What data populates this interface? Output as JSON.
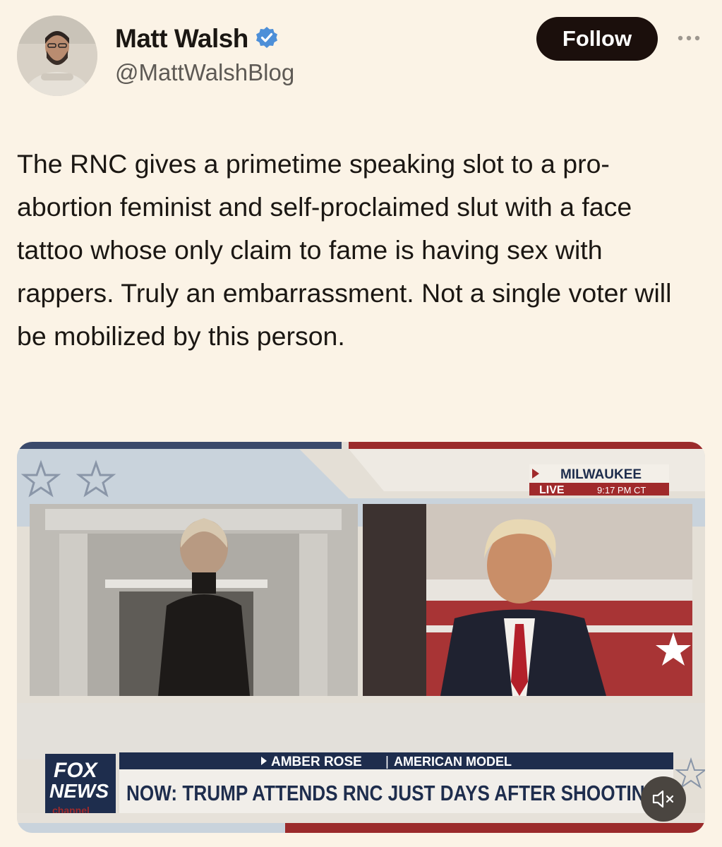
{
  "author": {
    "name": "Matt Walsh",
    "handle": "@MattWalshBlog",
    "verified_icon": "verified-badge-icon"
  },
  "actions": {
    "follow_label": "Follow",
    "more_icon": "more-options-icon"
  },
  "tweet": {
    "text": "The RNC gives a primetime speaking slot to a pro-abortion feminist and self-proclaimed slut with a face tattoo whose only claim to fame is having sex with rappers. Truly an embarrassment. Not a single voter will be mobilized by this person."
  },
  "video": {
    "location": "MILWAUKEE",
    "live_label": "LIVE",
    "time": "9:17 PM CT",
    "lower_third_name": "AMBER ROSE",
    "lower_third_role": "AMERICAN MODEL",
    "headline": "NOW: TRUMP ATTENDS RNC JUST DAYS AFTER SHOOTING",
    "network_top": "FOX",
    "network_mid": "NEWS",
    "network_bottom": "channel",
    "mute_icon": "speaker-muted-icon"
  },
  "colors": {
    "background": "#fbf3e6",
    "follow_button": "#1b0f0c",
    "verified_blue": "#4d8fd8",
    "fox_navy": "#1e2d4d",
    "red_accent": "#a02a2b"
  }
}
